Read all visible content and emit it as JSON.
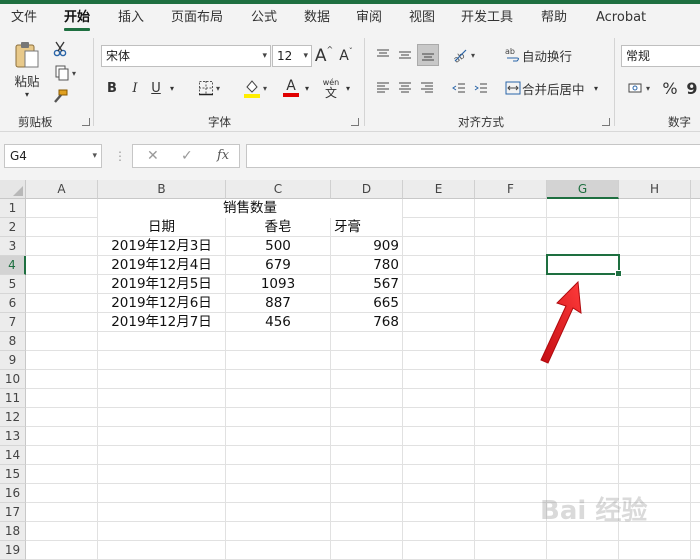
{
  "menu_tabs": [
    {
      "label": "文件"
    },
    {
      "label": "开始"
    },
    {
      "label": "插入"
    },
    {
      "label": "页面布局"
    },
    {
      "label": "公式"
    },
    {
      "label": "数据"
    },
    {
      "label": "审阅"
    },
    {
      "label": "视图"
    },
    {
      "label": "开发工具"
    },
    {
      "label": "帮助"
    },
    {
      "label": "Acrobat"
    }
  ],
  "ribbon": {
    "clipboard": {
      "paste_label": "粘贴",
      "group_label": "剪贴板"
    },
    "font": {
      "font_name": "宋体",
      "font_size": "12",
      "grow_label": "A",
      "shrink_label": "A",
      "bold": "B",
      "italic": "I",
      "underline": "U",
      "font_color_letter": "A",
      "wen_label": "wén",
      "wen_char": "文",
      "group_label": "字体"
    },
    "alignment": {
      "wrap_text": "自动换行",
      "merge_center": "合并后居中",
      "group_label": "对齐方式"
    },
    "number": {
      "format": "常规",
      "percent": "%",
      "comma": "9",
      "group_label": "数字"
    }
  },
  "formula_bar": {
    "name_box": "G4",
    "fx": "fx",
    "formula": ""
  },
  "columns": [
    "A",
    "B",
    "C",
    "D",
    "E",
    "F",
    "G",
    "H"
  ],
  "rows": [
    "1",
    "2",
    "3",
    "4",
    "5",
    "6",
    "7",
    "8",
    "9",
    "10",
    "11",
    "12",
    "13",
    "14",
    "15",
    "16",
    "17",
    "18",
    "19"
  ],
  "sheet": {
    "title": "销售数量",
    "headers": {
      "date": "日期",
      "soap": "香皂",
      "toothpaste": "牙膏"
    },
    "records": [
      {
        "date": "2019年12月3日",
        "soap": "500",
        "toothpaste": "909"
      },
      {
        "date": "2019年12月4日",
        "soap": "679",
        "toothpaste": "780"
      },
      {
        "date": "2019年12月5日",
        "soap": "1093",
        "toothpaste": "567"
      },
      {
        "date": "2019年12月6日",
        "soap": "887",
        "toothpaste": "665"
      },
      {
        "date": "2019年12月7日",
        "soap": "456",
        "toothpaste": "768"
      }
    ]
  },
  "selected_cell": "G4",
  "colors": {
    "accent": "#1e6f40",
    "arrow": "#e8161b"
  },
  "watermark": "Bai 经验"
}
